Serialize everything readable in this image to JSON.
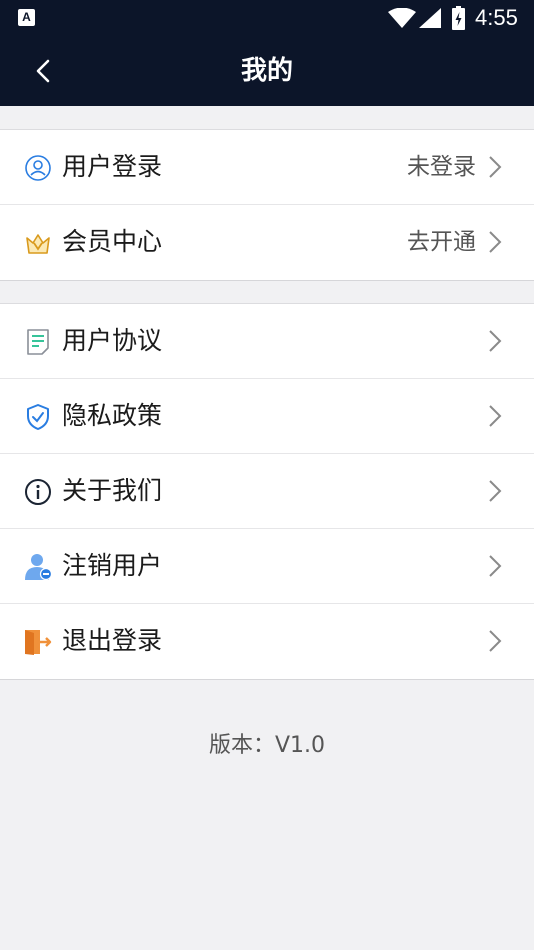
{
  "status_bar": {
    "app_icon_letter": "A",
    "time": "4:55"
  },
  "header": {
    "title": "我的"
  },
  "groups": [
    {
      "items": [
        {
          "label": "用户登录",
          "value": "未登录",
          "icon": "user-circle-icon"
        },
        {
          "label": "会员中心",
          "value": "去开通",
          "icon": "crown-icon"
        }
      ]
    },
    {
      "items": [
        {
          "label": "用户协议",
          "icon": "document-icon"
        },
        {
          "label": "隐私政策",
          "icon": "shield-check-icon"
        },
        {
          "label": "关于我们",
          "icon": "info-icon"
        },
        {
          "label": "注销用户",
          "icon": "user-remove-icon"
        },
        {
          "label": "退出登录",
          "icon": "logout-icon"
        }
      ]
    }
  ],
  "footer": {
    "version": "版本：V1.0"
  },
  "colors": {
    "header_bg": "#0c1529",
    "page_bg": "#f1f1f3",
    "icon_blue": "#2a7de1",
    "icon_green": "#37c49a",
    "icon_orange": "#f0913a",
    "icon_gold": "#e8b93a"
  }
}
